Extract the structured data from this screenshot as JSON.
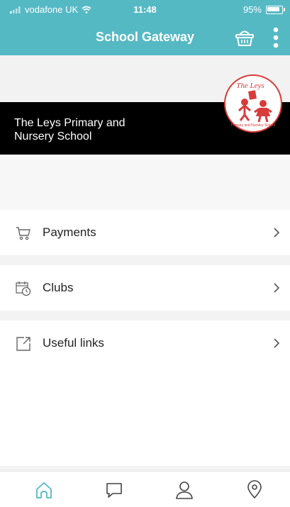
{
  "status_bar": {
    "carrier": "vodafone UK",
    "time": "11:48",
    "battery": "95%"
  },
  "header": {
    "title": "School Gateway",
    "basket_icon": "basket-icon",
    "more_icon": "more-vertical-icon"
  },
  "school": {
    "name": "The Leys Primary and Nursery School",
    "logo_text": "The Leys",
    "logo_subtext": "Primary and Nursery School"
  },
  "menu": [
    {
      "label": "Payments",
      "icon": "cart-icon"
    },
    {
      "label": "Clubs",
      "icon": "calendar-clock-icon"
    },
    {
      "label": "Useful links",
      "icon": "external-link-icon"
    }
  ],
  "tabs": [
    {
      "name": "home",
      "icon": "home-icon",
      "active": true
    },
    {
      "name": "messages",
      "icon": "chat-icon",
      "active": false
    },
    {
      "name": "profile",
      "icon": "user-icon",
      "active": false
    },
    {
      "name": "location",
      "icon": "location-pin-icon",
      "active": false
    }
  ],
  "colors": {
    "accent": "#55b9c4",
    "banner": "#000000",
    "logo_red": "#d93a3a"
  }
}
